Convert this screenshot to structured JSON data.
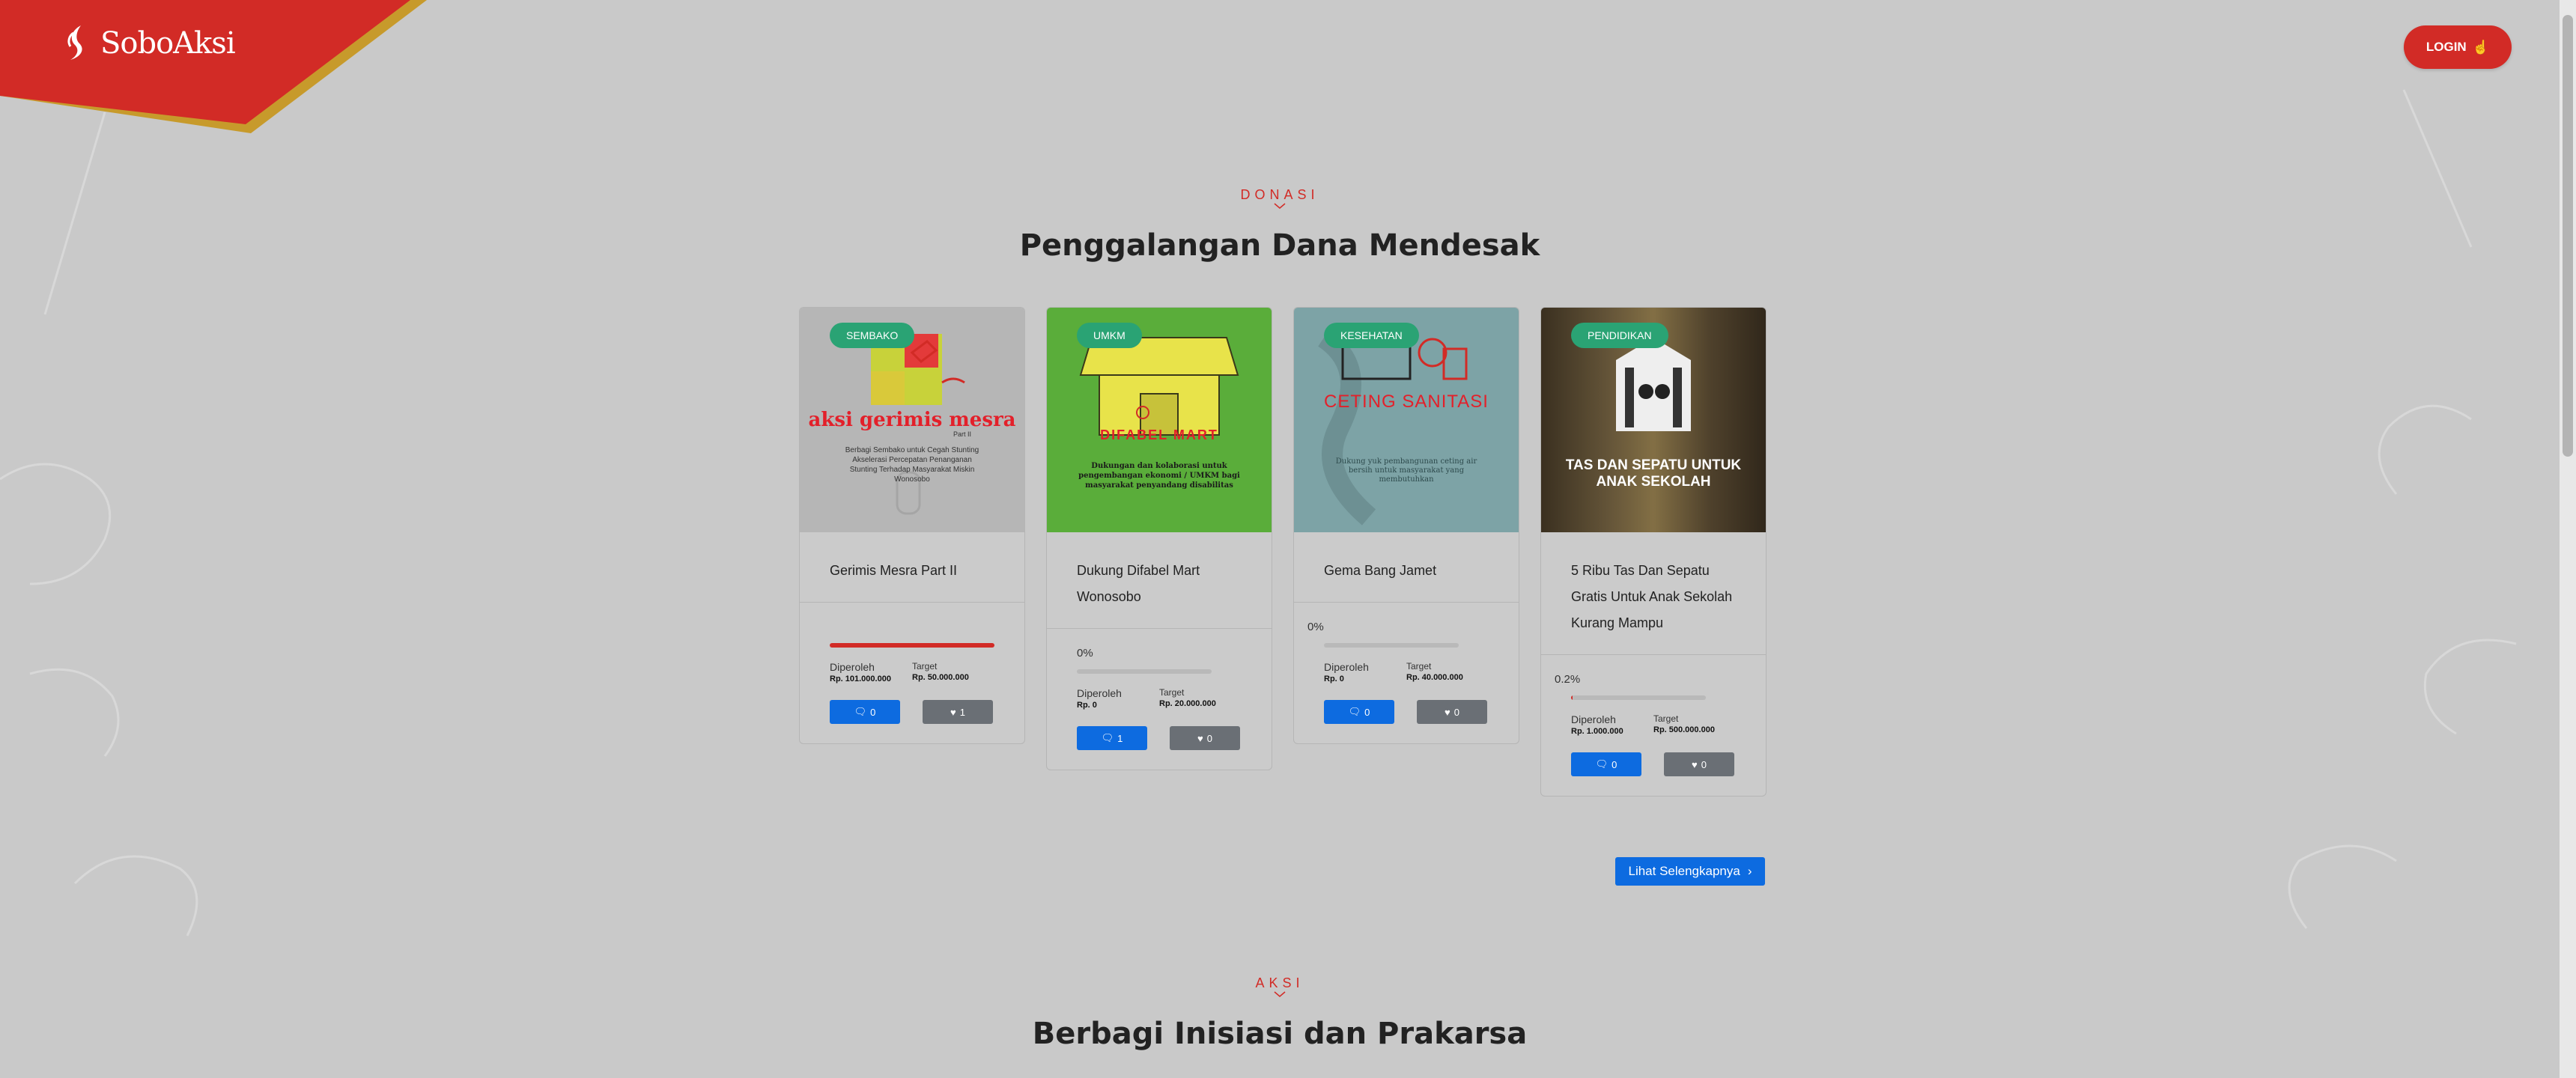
{
  "brand": {
    "name": "SoboAksi"
  },
  "header": {
    "login_label": "LOGIN"
  },
  "donasi": {
    "tag": "DONASI",
    "title": "Penggalangan Dana Mendesak",
    "more_label": "Lihat Selengkapnya",
    "cards": [
      {
        "category": "SEMBAKO",
        "title": "Gerimis Mesra Part II",
        "image_heading": "aksi gerimis mesra",
        "image_subheading": "Part II",
        "image_caption": "Berbagi Sembako untuk Cegah Stunting Akselerasi Percepatan Penanganan Stunting Terhadap Masyarakat Miskin Wonosobo",
        "percent": "",
        "progress": 1.0,
        "received_label": "Diperoleh",
        "received": "Rp. 101.000.000",
        "target_label": "Target",
        "target": "Rp. 50.000.000",
        "comments": "0",
        "likes": "1"
      },
      {
        "category": "UMKM",
        "title": "Dukung Difabel Mart Wonosobo",
        "image_heading": "DIFABEL MART",
        "image_caption": "Dukungan dan kolaborasi untuk pengembangan ekonomi / UMKM bagi masyarakat penyandang disabilitas",
        "percent": "0%",
        "progress": 0.0,
        "received_label": "Diperoleh",
        "received": "Rp. 0",
        "target_label": "Target",
        "target": "Rp. 20.000.000",
        "comments": "1",
        "likes": "0"
      },
      {
        "category": "KESEHATAN",
        "title": "Gema Bang Jamet",
        "image_heading": "CETING SANITASI",
        "image_caption": "Dukung yuk pembangunan ceting air bersih untuk masyarakat yang membutuhkan",
        "percent": "0%",
        "progress": 0.0,
        "received_label": "Diperoleh",
        "received": "Rp. 0",
        "target_label": "Target",
        "target": "Rp. 40.000.000",
        "comments": "0",
        "likes": "0"
      },
      {
        "category": "PENDIDIKAN",
        "title": "5 Ribu Tas Dan Sepatu Gratis Untuk Anak Sekolah Kurang Mampu",
        "image_heading": "TAS DAN SEPATU UNTUK ANAK SEKOLAH",
        "image_caption": "",
        "percent": "0.2%",
        "progress": 0.002,
        "received_label": "Diperoleh",
        "received": "Rp. 1.000.000",
        "target_label": "Target",
        "target": "Rp. 500.000.000",
        "comments": "0",
        "likes": "0"
      }
    ]
  },
  "aksi": {
    "tag": "AKSI",
    "title": "Berbagi Inisiasi dan Prakarsa"
  },
  "colors": {
    "brand_red": "#d22b26",
    "badge_green": "#2aa374",
    "button_blue": "#0d6be0",
    "button_gray": "#6a6f75",
    "page_bg": "#c9c9c9"
  },
  "icons": {
    "login": "login-hand-icon",
    "comment": "comment-icon",
    "like": "heart-icon",
    "more": "chevron-right-icon"
  }
}
